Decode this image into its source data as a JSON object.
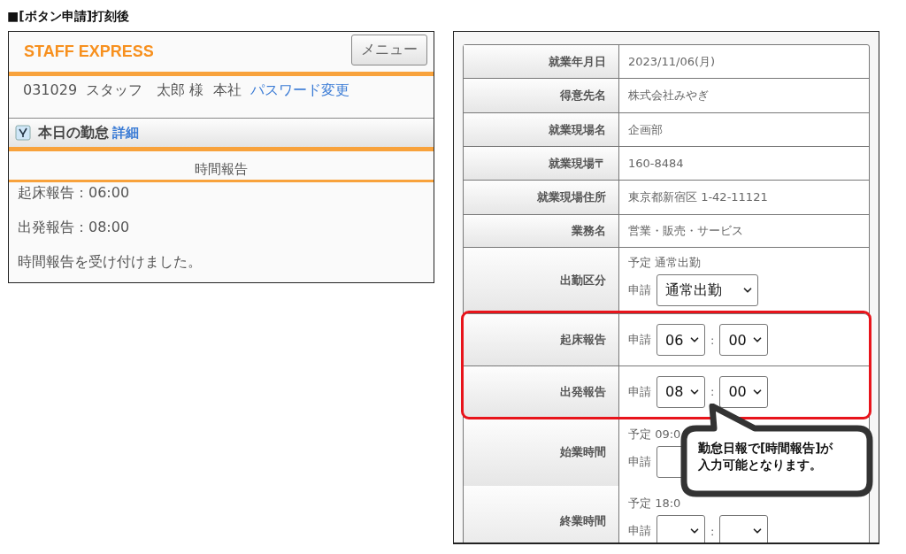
{
  "heading": "■[ボタン申請]打刻後",
  "mobile": {
    "logo": "STAFF EXPRESS",
    "menu_button": "メニュー",
    "user_info": "031029  スタッフ　太郎 様  本社",
    "password_link": "パスワード変更",
    "section": {
      "title": "本日の勤怠",
      "detail_link": "詳細"
    },
    "subheader": "時間報告",
    "lines": [
      "起床報告：06:00",
      "出発報告：08:00",
      "時間報告を受け付けました。"
    ]
  },
  "form": {
    "rows": [
      {
        "kind": "text",
        "label": "就業年月日",
        "value": "2023/11/06(月)",
        "highlighted": false
      },
      {
        "kind": "text",
        "label": "得意先名",
        "value": "株式会社みやぎ",
        "highlighted": false
      },
      {
        "kind": "text",
        "label": "就業現場名",
        "value": "企画部",
        "highlighted": false
      },
      {
        "kind": "text",
        "label": "就業現場〒",
        "value": "160-8484",
        "highlighted": false
      },
      {
        "kind": "text",
        "label": "就業現場住所",
        "value": "東京都新宿区 1-42-11121",
        "highlighted": false
      },
      {
        "kind": "text",
        "label": "業務名",
        "value": "営業・販売・サービス",
        "highlighted": false
      },
      {
        "kind": "select",
        "label": "出勤区分",
        "planned": "予定 通常出勤",
        "request_label": "申請",
        "value": "通常出勤",
        "highlighted": false
      },
      {
        "kind": "time",
        "label": "起床報告",
        "request_label": "申請",
        "hour": "06",
        "separator": ":",
        "minute": "00",
        "highlighted": true
      },
      {
        "kind": "time",
        "label": "出発報告",
        "request_label": "申請",
        "hour": "08",
        "separator": ":",
        "minute": "00",
        "highlighted": true
      },
      {
        "kind": "time",
        "label": "始業時間",
        "planned": "予定 09:0",
        "request_label": "申請",
        "highlighted": false
      },
      {
        "kind": "time",
        "label": "終業時間",
        "planned": "予定 18:0",
        "request_label": "申請",
        "separator": ":",
        "highlighted": false
      }
    ],
    "callout_lines": [
      "勤怠日報で[時間報告]が",
      "入力可能となります。"
    ]
  }
}
